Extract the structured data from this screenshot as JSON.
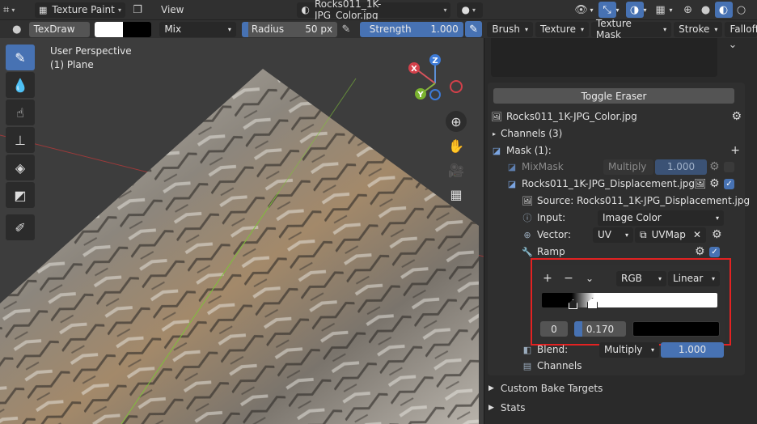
{
  "header": {
    "mode_label": "Texture Paint",
    "view_label": "View",
    "image_name": "Rocks011_1K-JPG_Color.jpg"
  },
  "tool_settings": {
    "brush_name": "TexDraw",
    "blend_mode": "Mix",
    "radius_label": "Radius",
    "radius_value": "50 px",
    "strength_label": "Strength",
    "strength_value": "1.000",
    "menus": [
      "Brush",
      "Texture",
      "Texture Mask",
      "Stroke",
      "Falloff"
    ]
  },
  "viewport": {
    "perspective": "User Perspective",
    "object": "(1) Plane",
    "gizmo": {
      "z": "Z",
      "x": "X",
      "y": "Y"
    }
  },
  "panel": {
    "toggle_eraser": "Toggle Eraser",
    "layer_name": "Rocks011_1K-JPG_Color.jpg",
    "channels_label": "Channels (3)",
    "mask_label": "Mask (1):",
    "mixmask_label": "MixMask",
    "mixmask_blend": "Multiply",
    "mixmask_value": "1.000",
    "mask_layer_name": "Rocks011_1K-JPG_Displacement.jpg",
    "source_label": "Source: Rocks011_1K-JPG_Displacement.jpg",
    "input_label": "Input:",
    "input_value": "Image Color",
    "vector_label": "Vector:",
    "vector_mode": "UV",
    "uvmap": "UVMap",
    "ramp_label": "Ramp",
    "ramp": {
      "add": "+",
      "remove": "−",
      "menu": "⌄",
      "color_mode": "RGB",
      "interpolation": "Linear",
      "index_value": "0",
      "position_value": "0.170"
    },
    "blend_label": "Blend:",
    "blend_value": "Multiply",
    "blend_factor": "1.000",
    "channels_row": "Channels",
    "custom_bake_targets": "Custom Bake Targets",
    "stats": "Stats"
  }
}
